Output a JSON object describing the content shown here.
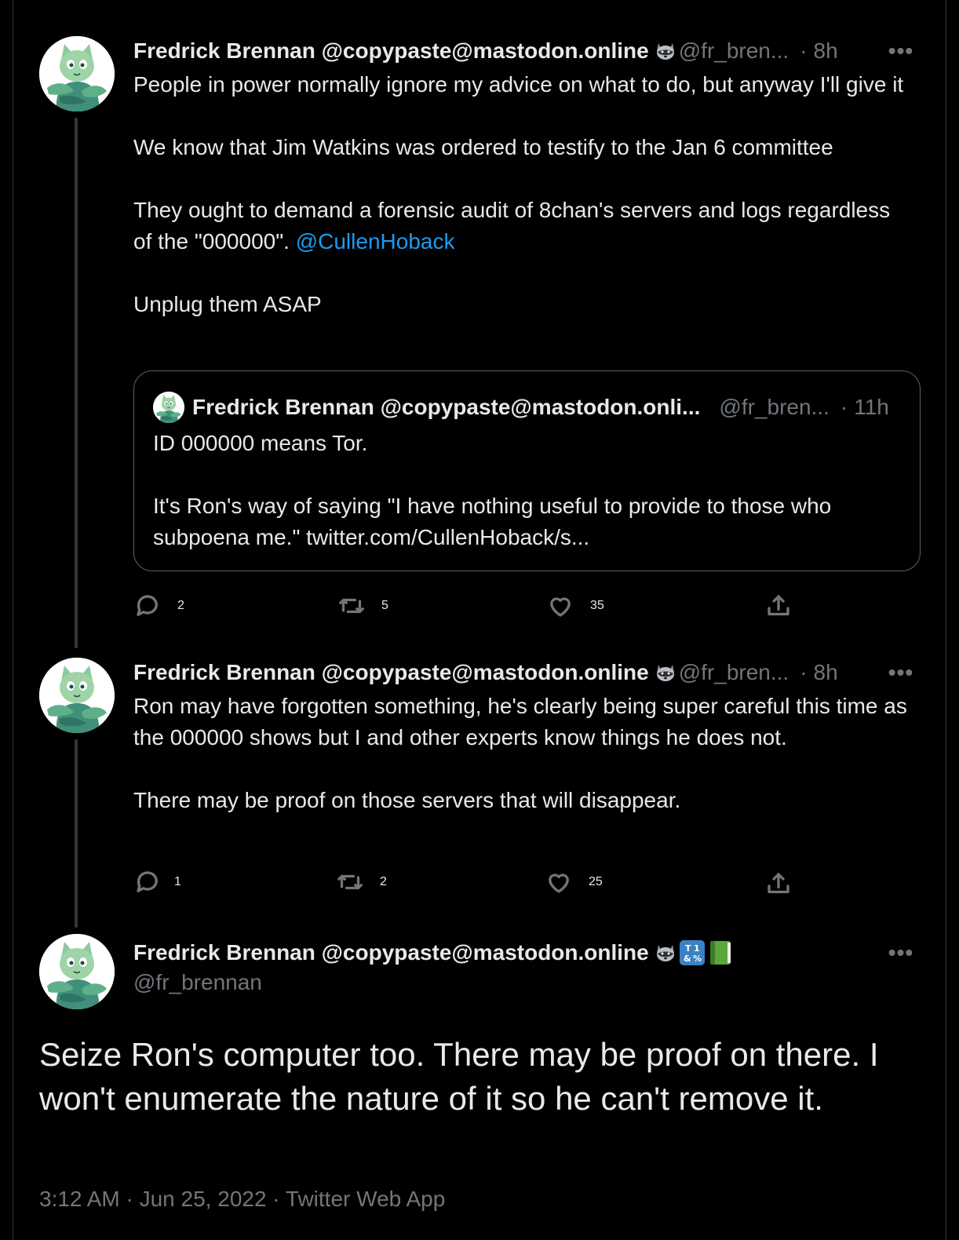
{
  "tweets": [
    {
      "name": "Fredrick Brennan @copypaste@mastodon.online",
      "handle": "@fr_bren...",
      "time": "8h",
      "paragraphs": [
        "People in power normally ignore my advice on what to do, but anyway I'll give it",
        "We know that Jim Watkins was ordered to testify to the Jan 6 committee"
      ],
      "paragraph3_text": "They ought to demand a forensic audit of 8chan's servers and logs regardless of the \"000000\". ",
      "paragraph3_mention": "@CullenHoback",
      "paragraph4": "Unplug them ASAP",
      "quote": {
        "name": "Fredrick Brennan @copypaste@mastodon.onli...",
        "handle": "@fr_bren...",
        "time": "11h",
        "paragraphs": [
          "ID 000000 means Tor.",
          "It's Ron's way of saying \"I have nothing useful to provide to those who subpoena me.\" twitter.com/CullenHoback/s..."
        ]
      },
      "replies": "2",
      "retweets": "5",
      "likes": "35"
    },
    {
      "name": "Fredrick Brennan @copypaste@mastodon.online",
      "handle": "@fr_bren...",
      "time": "8h",
      "paragraphs": [
        "Ron may have forgotten something, he's clearly being super careful this time as the 000000 shows but I and other experts know things he does not.",
        "There may be proof on those servers that will disappear."
      ],
      "replies": "1",
      "retweets": "2",
      "likes": "25"
    }
  ],
  "main_tweet": {
    "name": "Fredrick Brennan @copypaste@mastodon.online",
    "badge_symbols": "T̲1 &%",
    "handle": "@fr_brennan",
    "text": "Seize Ron's computer too. There may be proof on there. I won't enumerate the nature of it so he can't remove it.",
    "timestamp": "3:12 AM · Jun 25, 2022 · Twitter Web App"
  },
  "icons": {
    "more": "more-icon",
    "reply": "reply-icon",
    "retweet": "retweet-icon",
    "like": "like-icon",
    "share": "share-icon",
    "raccoon": "raccoon-emoji-icon",
    "symbols": "input-symbols-emoji-icon",
    "book": "green-book-emoji-icon"
  },
  "colors": {
    "background": "#000000",
    "text": "#e7e9ea",
    "muted": "#71767b",
    "link": "#1d9bf0",
    "border": "#2f3336"
  }
}
